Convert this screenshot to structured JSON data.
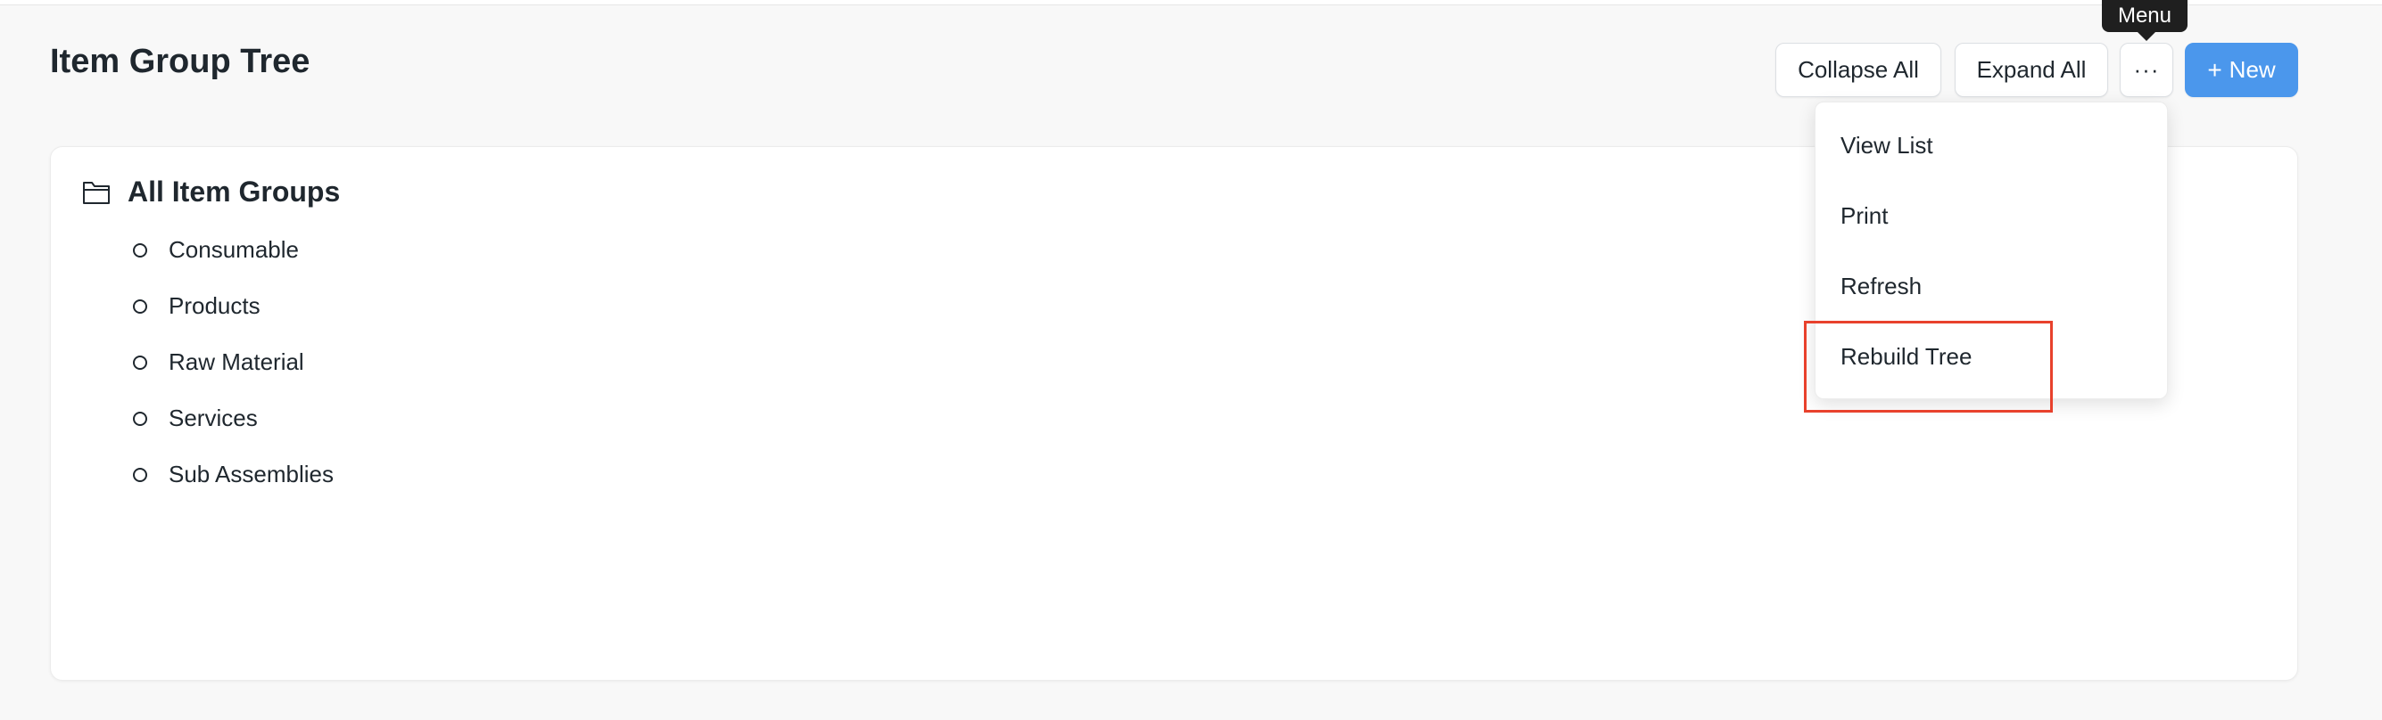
{
  "page": {
    "title": "Item Group Tree"
  },
  "toolbar": {
    "collapse_all": "Collapse All",
    "expand_all": "Expand All",
    "menu_glyph": "···",
    "new_plus": "+",
    "new_label": "New",
    "menu_tooltip": "Menu"
  },
  "menu": {
    "items": [
      {
        "label": "View List"
      },
      {
        "label": "Print"
      },
      {
        "label": "Refresh"
      },
      {
        "label": "Rebuild Tree"
      }
    ]
  },
  "tree": {
    "root_label": "All Item Groups",
    "root_icon": "folder-icon",
    "children": [
      {
        "label": "Consumable"
      },
      {
        "label": "Products"
      },
      {
        "label": "Raw Material"
      },
      {
        "label": "Services"
      },
      {
        "label": "Sub Assemblies"
      }
    ]
  },
  "colors": {
    "primary": "#4b97ec",
    "highlight": "#e8412c",
    "tooltip_bg": "#1f1f1f"
  }
}
